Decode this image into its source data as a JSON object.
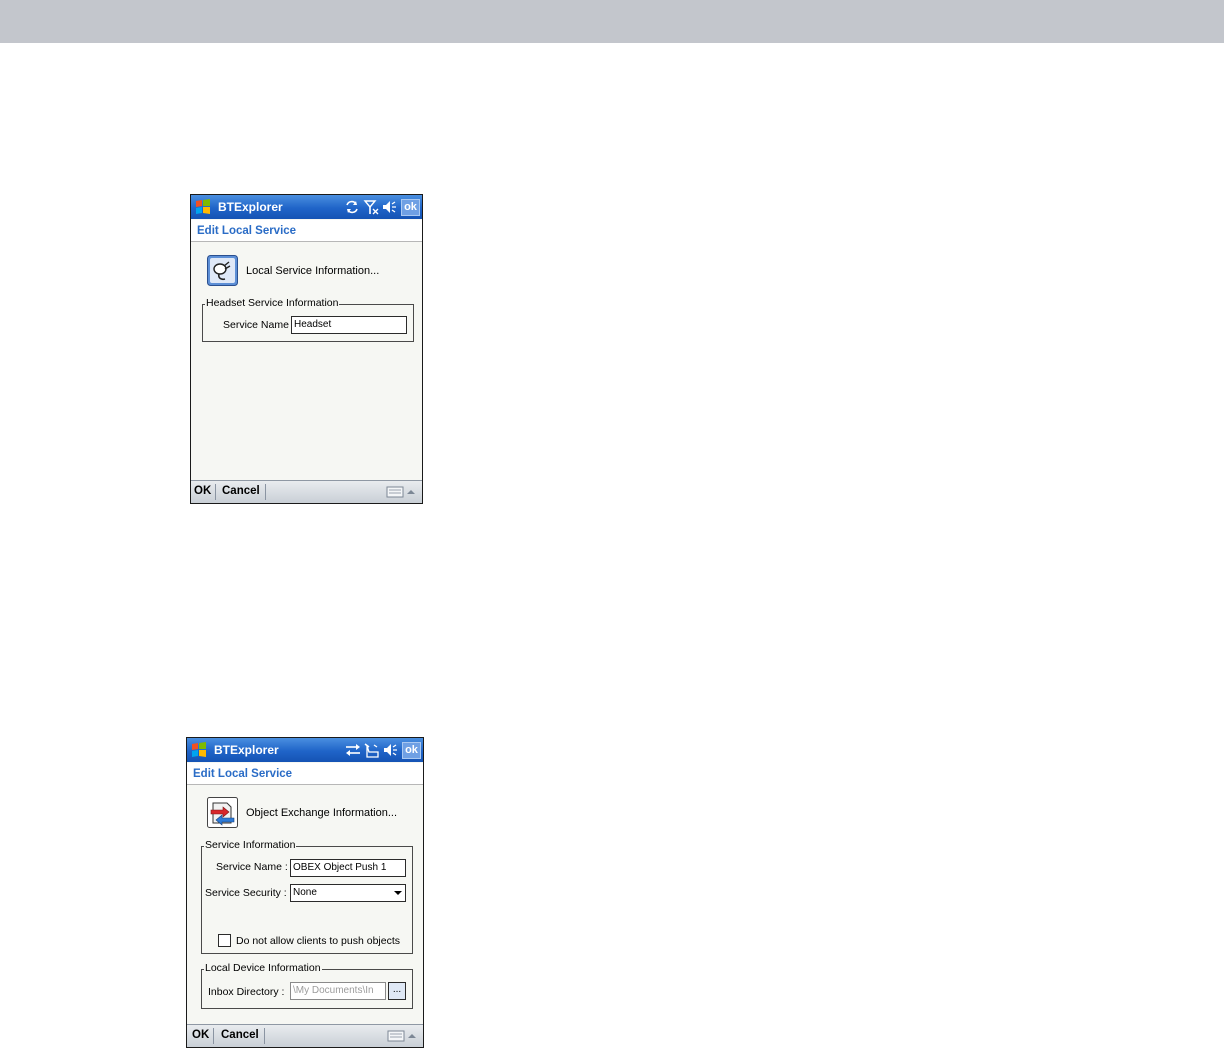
{
  "screens": [
    {
      "app_title": "BTExplorer",
      "ok_label": "ok",
      "header": "Edit Local Service",
      "info_text": "Local Service Information...",
      "group": {
        "legend": "Headset Service Information",
        "service_name_label": "Service Name",
        "service_name_value": "Headset"
      },
      "menu": {
        "ok": "OK",
        "cancel": "Cancel"
      },
      "tray_icons": [
        "sync-icon",
        "signal-off-icon",
        "volume-icon"
      ],
      "info_icon": "headset-plug-icon"
    },
    {
      "app_title": "BTExplorer",
      "ok_label": "ok",
      "header": "Edit Local Service",
      "info_text": "Object Exchange Information...",
      "service_group": {
        "legend": "Service Information",
        "service_name_label": "Service Name :",
        "service_name_value": "OBEX Object Push 1",
        "service_security_label": "Service Security :",
        "service_security_value": "None",
        "checkbox_label": "Do not allow clients to push objects",
        "checkbox_checked": false
      },
      "device_group": {
        "legend": "Local Device Information",
        "inbox_label": "Inbox Directory :",
        "inbox_value": "\\My Documents\\In",
        "browse_label": "..."
      },
      "menu": {
        "ok": "OK",
        "cancel": "Cancel"
      },
      "tray_icons": [
        "connectivity-icon",
        "alarm-icon",
        "volume-icon"
      ],
      "info_icon": "object-exchange-icon"
    }
  ],
  "colors": {
    "titlebar": "#1f64c8",
    "header_text": "#2a6cc6",
    "background": "#f6f7f3",
    "top_band": "#c3c6cc"
  }
}
